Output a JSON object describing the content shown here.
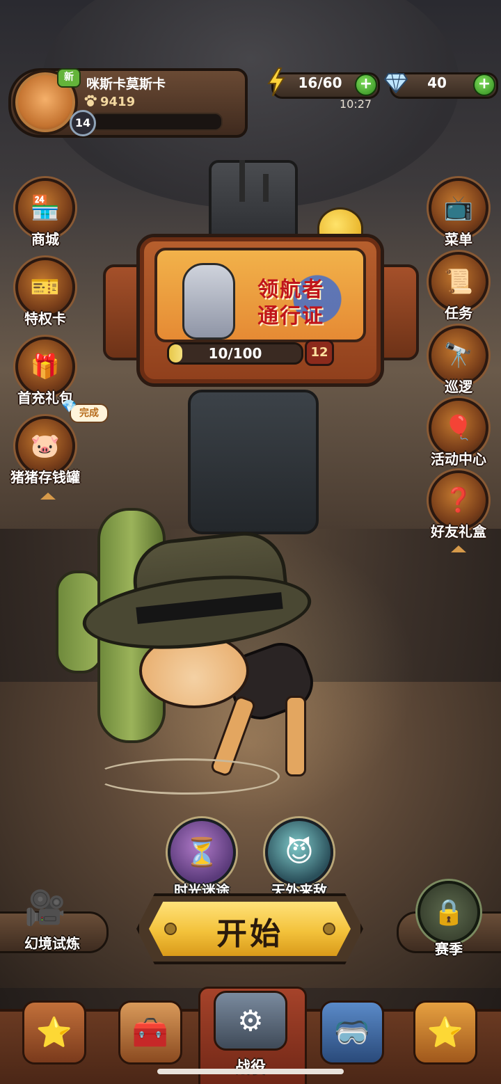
{
  "header": {
    "new_badge": "新",
    "player_name": "咪斯卡莫斯卡",
    "coins": "9419",
    "level": "14",
    "energy": "16/60",
    "gems": "40",
    "time": "10:27",
    "plus": "+"
  },
  "battle_pass": {
    "title_line1": "领航者",
    "title_line2": "通行证",
    "progress_text": "10/100",
    "progress": 0.1,
    "level": "12"
  },
  "left_menu": [
    {
      "label": "商城",
      "icon": "shop-icon"
    },
    {
      "label": "特权卡",
      "icon": "privilege-card-icon"
    },
    {
      "label": "首充礼包",
      "icon": "first-recharge-gift-icon"
    },
    {
      "label": "猪猪存钱罐",
      "icon": "piggy-bank-icon"
    }
  ],
  "piggy_status": "完成",
  "right_menu": [
    {
      "label": "菜单",
      "icon": "menu-icon"
    },
    {
      "label": "任务",
      "icon": "task-scroll-icon"
    },
    {
      "label": "巡逻",
      "icon": "binoculars-icon"
    },
    {
      "label": "活动中心",
      "icon": "balloons-icon"
    },
    {
      "label": "好友礼盒",
      "icon": "gift-box-icon"
    }
  ],
  "modes": [
    {
      "label": "时光迷途",
      "icon": "time-maze-icon"
    },
    {
      "label": "天外来敌",
      "icon": "alien-enemy-icon"
    }
  ],
  "start_label": "开始",
  "trial_label": "幻境试炼",
  "season_label": "赛季",
  "bottom_nav": [
    {
      "icon": "treasure-chest-icon"
    },
    {
      "icon": "toolbox-icon"
    },
    {
      "label": "战役",
      "icon": "campaign-machine-icon"
    },
    {
      "icon": "goggles-bag-icon"
    },
    {
      "icon": "star-box-icon"
    }
  ],
  "colors": {
    "start_button": "#f3c23b",
    "pass_title": "#c0151a",
    "plus_button": "#2f8a1e"
  }
}
